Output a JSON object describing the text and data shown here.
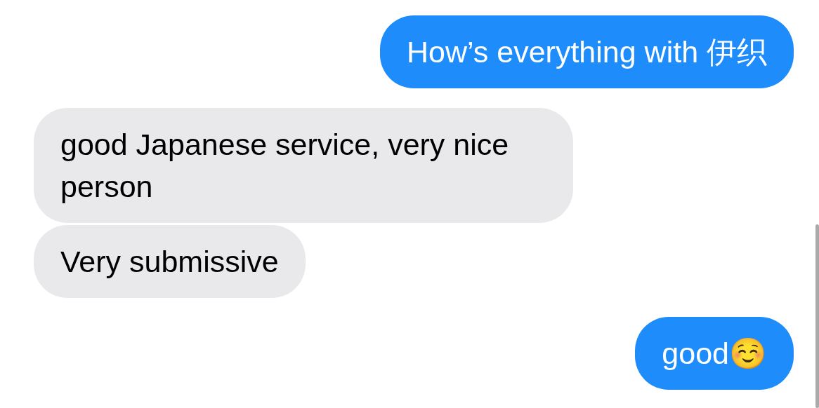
{
  "messages": [
    {
      "kind": "sent",
      "text": "How’s everything with 伊织"
    },
    {
      "kind": "received",
      "text": "good Japanese service, very nice person"
    },
    {
      "kind": "received",
      "text": "Very submissive"
    },
    {
      "kind": "sent",
      "text": "good☺️"
    }
  ]
}
